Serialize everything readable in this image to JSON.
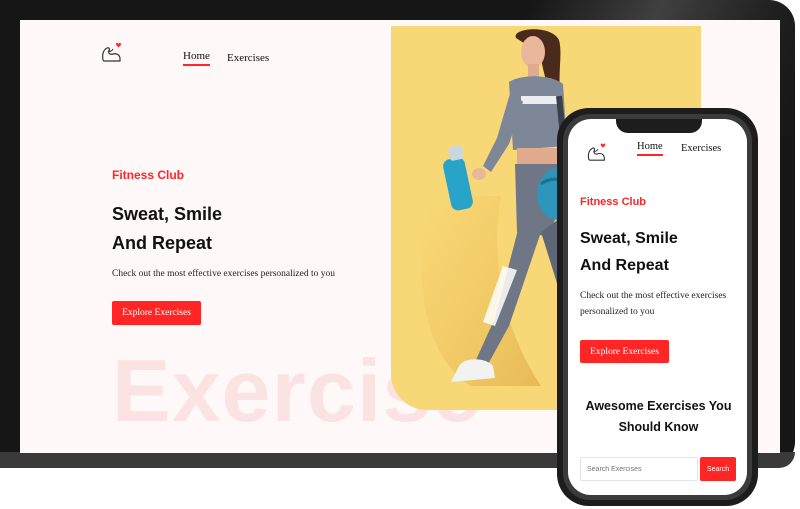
{
  "brand": {
    "accent": "#ff2625",
    "banner_color": "#f8d876",
    "bg_word_color": "#fbe3e3",
    "logo_icon": "flexed-arm-heart-icon"
  },
  "desktop": {
    "nav": {
      "home": "Home",
      "exercises": "Exercises"
    },
    "hero": {
      "eyebrow": "Fitness Club",
      "title_line1": "Sweat, Smile",
      "title_line2": "And Repeat",
      "description": "Check out the most effective exercises personalized to you",
      "cta": "Explore Exercises",
      "background_word": "Exercise"
    },
    "banner_image": "woman-walking-with-water-bottle"
  },
  "mobile": {
    "nav": {
      "home": "Home",
      "exercises": "Exercises"
    },
    "hero": {
      "eyebrow": "Fitness Club",
      "title_line1": "Sweat, Smile",
      "title_line2": "And Repeat",
      "description": "Check out the most effective exercises personalized to you",
      "cta": "Explore Exercises"
    },
    "section": {
      "title_line1": "Awesome Exercises You",
      "title_line2": "Should Know"
    },
    "search": {
      "placeholder": "Search Exercises",
      "button": "Search"
    }
  }
}
